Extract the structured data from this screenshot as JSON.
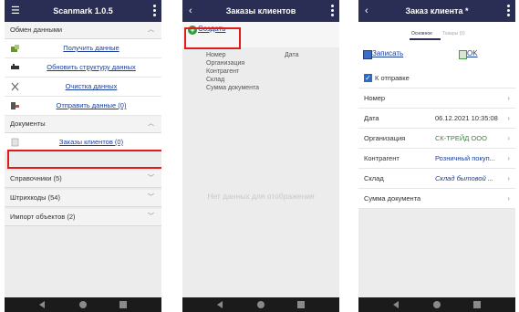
{
  "screen1": {
    "title": "Scanmark 1.0.5",
    "sections": {
      "exchange": "Обмен данными",
      "documents": "Документы",
      "directories": "Справочники (5)",
      "barcodes": "Штрихкоды (54)",
      "import": "Импорт объектов (2)"
    },
    "exchange_items": {
      "receive": "Получить данные",
      "update_structure": "Обновить структуру данных",
      "clear": "Очистка данных",
      "send": "Отправить данные (0)"
    },
    "documents_items": {
      "customer_orders": "Заказы клиентов (0)"
    }
  },
  "screen2": {
    "title": "Заказы клиентов",
    "create": "Создать",
    "columns": {
      "number": "Номер",
      "date": "Дата",
      "organization": "Организация",
      "counterparty": "Контрагент",
      "warehouse": "Склад",
      "sum": "Сумма документа"
    },
    "empty": "Нет данных для отображения"
  },
  "screen3": {
    "title": "Заказ клиента *",
    "tabs": {
      "main": "Основное",
      "goods": "Товары (0)"
    },
    "save": "Записать",
    "ok": "OK",
    "to_send": "К отправке",
    "fields": {
      "number": {
        "label": "Номер",
        "value": ""
      },
      "date": {
        "label": "Дата",
        "value": "06.12.2021 10:35:08"
      },
      "organization": {
        "label": "Организация",
        "value": "СК-ТРЕЙД ООО"
      },
      "counterparty": {
        "label": "Контрагент",
        "value": "Розничный покуп..."
      },
      "warehouse": {
        "label": "Склад",
        "value": "Склад бытовой ..."
      },
      "sum": {
        "label": "Сумма документа",
        "value": ""
      }
    }
  },
  "colors": {
    "topbar": "#2a2e55",
    "link": "#1a3f9c",
    "highlight": "#e01b1b",
    "green": "#2e9a3a"
  }
}
